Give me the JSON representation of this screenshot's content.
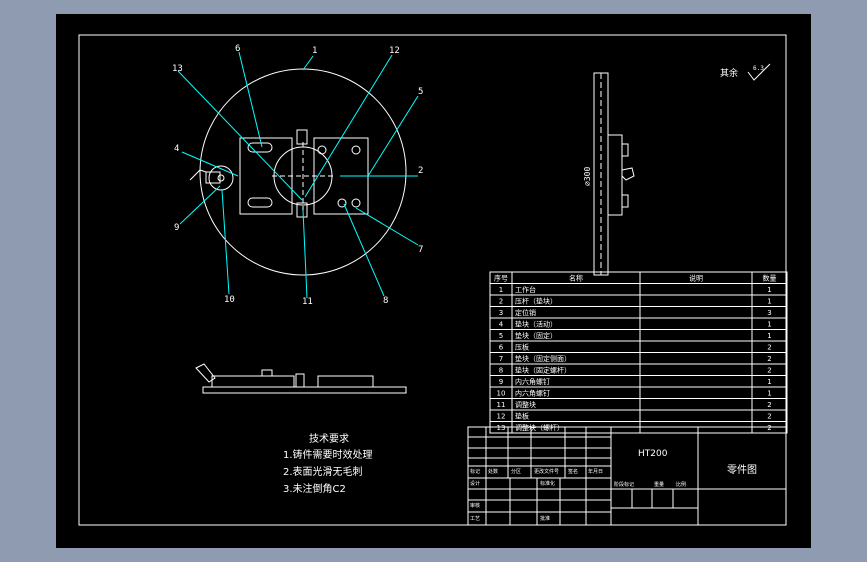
{
  "colors": {
    "backdrop": "#8f9bb0",
    "paper": "#000000",
    "line": "#ffffff",
    "leader": "#00ffff",
    "magenta": "#ff00ff"
  },
  "drawing": {
    "balloons": [
      "1",
      "2",
      "4",
      "5",
      "6",
      "7",
      "8",
      "9",
      "10",
      "11",
      "12",
      "13"
    ],
    "side_dimension": "⌀300",
    "roughness_note": "其余",
    "roughness_value": "6.3"
  },
  "tech_requirements": {
    "title": "技术要求",
    "items": [
      "1.铸件需要时效处理",
      "2.表面光滑无毛刺",
      "3.未注倒角C2"
    ]
  },
  "parts_table": {
    "headers": [
      "序号",
      "名称",
      "说明",
      "数量"
    ],
    "rows": [
      {
        "no": "1",
        "name": "工作台",
        "qty": "1"
      },
      {
        "no": "2",
        "name": "压杆（垫块）",
        "qty": "1"
      },
      {
        "no": "3",
        "name": "定位销",
        "qty": "3"
      },
      {
        "no": "4",
        "name": "垫块（活动）",
        "qty": "1"
      },
      {
        "no": "5",
        "name": "垫块（固定）",
        "qty": "1"
      },
      {
        "no": "6",
        "name": "压板",
        "qty": "2"
      },
      {
        "no": "7",
        "name": "垫块（固定侧面）",
        "qty": "2"
      },
      {
        "no": "8",
        "name": "垫块（固定螺杆）",
        "qty": "2"
      },
      {
        "no": "9",
        "name": "内六角螺钉",
        "qty": "1"
      },
      {
        "no": "10",
        "name": "内六角螺钉",
        "qty": "1"
      },
      {
        "no": "11",
        "name": "调整块",
        "qty": "2"
      },
      {
        "no": "12",
        "name": "垫板",
        "qty": "2"
      },
      {
        "no": "13",
        "name": "调整块（螺杆）",
        "qty": "2"
      }
    ]
  },
  "title_block": {
    "drawing_no": "HT200",
    "drawing_name": "零件图",
    "labels": [
      "标记",
      "处数",
      "分区",
      "更改文件号",
      "签名",
      "年月日",
      "设计",
      "标准化",
      "阶段标记",
      "重量",
      "比例",
      "审核",
      "工艺",
      "批准"
    ]
  }
}
